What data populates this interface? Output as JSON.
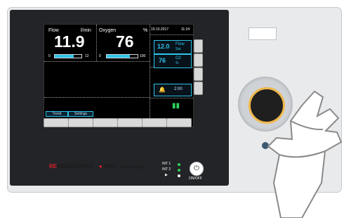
{
  "screen": {
    "flow": {
      "label": "Flow",
      "unit": "l/min",
      "value": "11.9",
      "bar_min": "0",
      "bar_max": "12",
      "bar_fraction": 0.72
    },
    "oxygen": {
      "label": "Oxygen",
      "unit": "%",
      "value": "76",
      "bar_min": "0",
      "bar_max": "100",
      "bar_fraction": 0.76
    },
    "date": "19.10.2017",
    "time": "11:24",
    "flow_set": {
      "value": "12.0",
      "label": "Flow",
      "sub": "Set"
    },
    "o2_set": {
      "value": "76",
      "label": "O2",
      "sub": "%"
    },
    "alarm": {
      "time": "2:00"
    },
    "tabs": [
      "Trend",
      "Settings"
    ]
  },
  "device": {
    "brand": "RESUSCITEC",
    "brand2": "MOX",
    "brand2_sub": "oxygen supply",
    "int1": "INT 1",
    "int2": "INT 2",
    "onoff": "ON/OFF"
  },
  "colors": {
    "accent": "#2ec4e8",
    "green": "#2fd35a",
    "knob_ring": "#f0b84b"
  }
}
